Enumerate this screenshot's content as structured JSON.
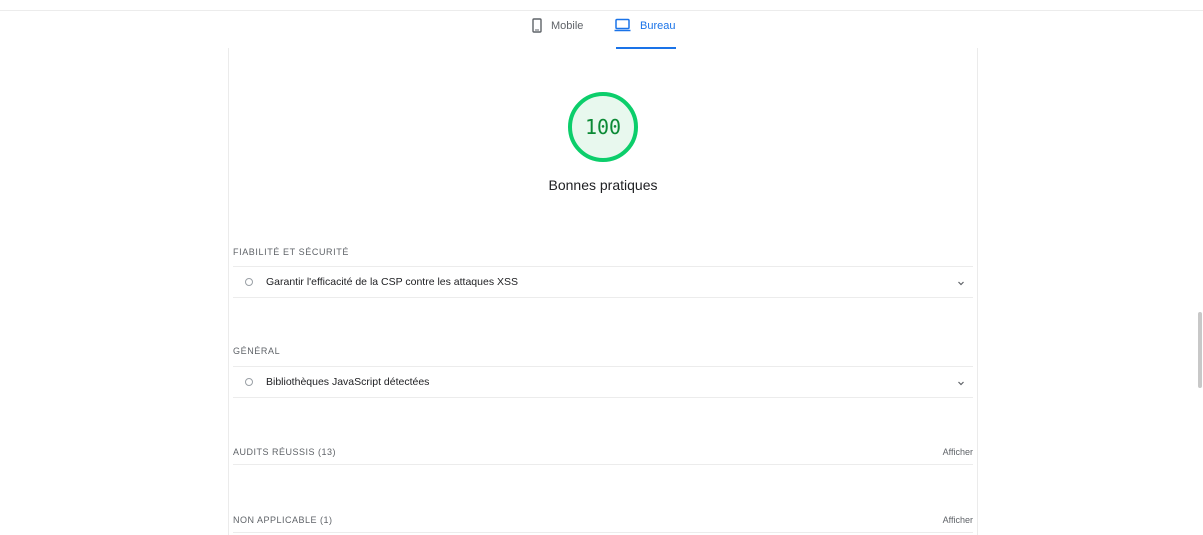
{
  "tabs": {
    "mobile_label": "Mobile",
    "desktop_label": "Bureau",
    "active": "Bureau",
    "active_color": "#1a73e8"
  },
  "score": {
    "value": "100",
    "title": "Bonnes pratiques",
    "level": 1.0,
    "ring_color": "#0cce6b",
    "fill_color": "#e8f8ee",
    "text_color": "#0b8a35"
  },
  "groups": [
    {
      "title": "FIABILITÉ ET SÉCURITÉ",
      "audits": [
        {
          "label": "Garantir l'efficacité de la CSP contre les attaques XSS"
        }
      ]
    },
    {
      "title": "GÉNÉRAL",
      "audits": [
        {
          "label": "Bibliothèques JavaScript détectées"
        }
      ]
    }
  ],
  "sections": [
    {
      "label": "AUDITS RÉUSSIS (13)",
      "action": "Afficher"
    },
    {
      "label": "NON APPLICABLE (1)",
      "action": "Afficher"
    }
  ]
}
